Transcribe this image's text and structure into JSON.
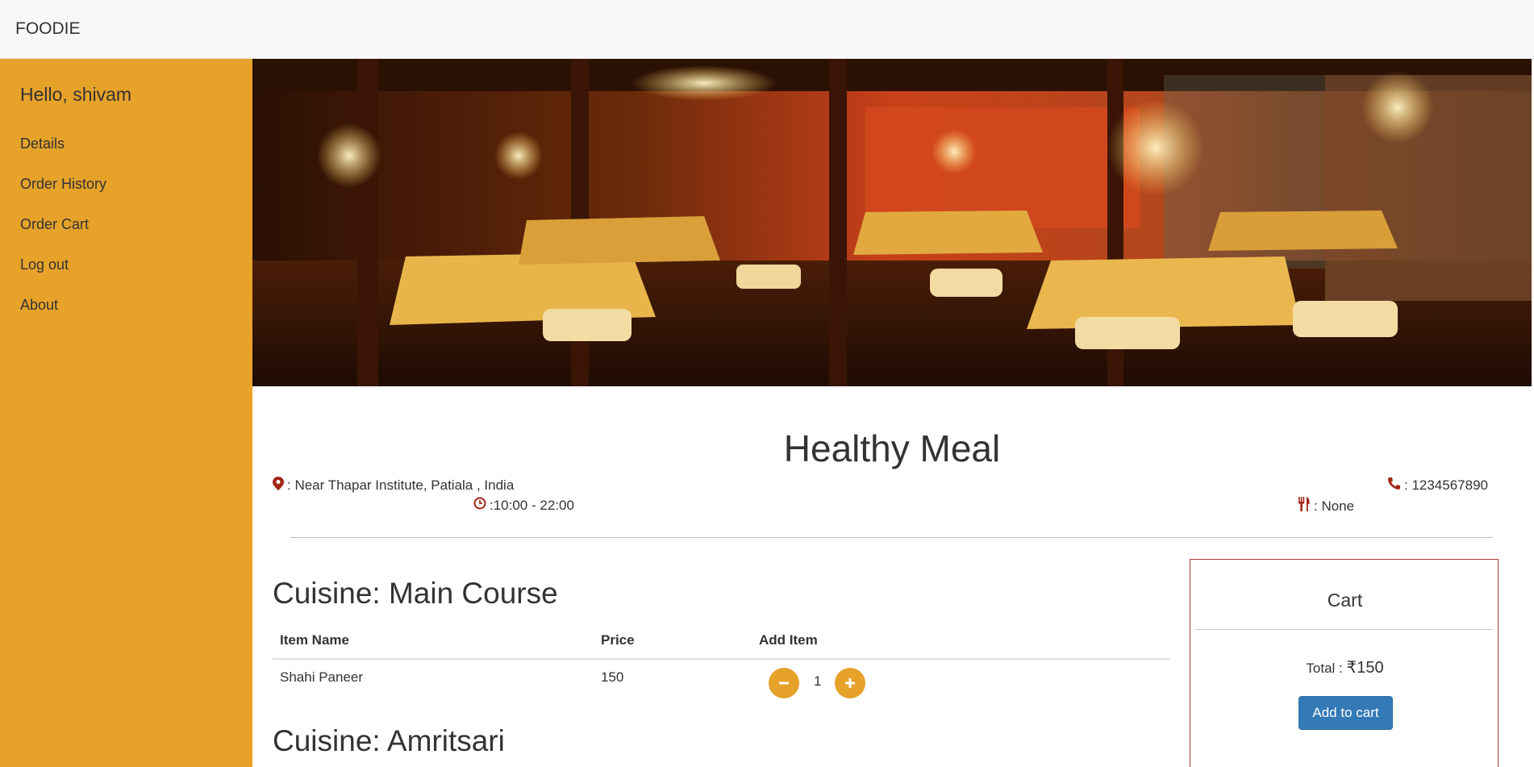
{
  "navbar": {
    "brand": "FOODIE"
  },
  "sidebar": {
    "greeting": "Hello, shivam",
    "items": [
      {
        "label": "Details"
      },
      {
        "label": "Order History"
      },
      {
        "label": "Order Cart"
      },
      {
        "label": "Log out"
      },
      {
        "label": "About"
      }
    ]
  },
  "restaurant": {
    "name": "Healthy Meal",
    "address": ": Near Thapar Institute, Patiala , India",
    "hours": ":10:00 - 22:00",
    "phone": ": 1234567890",
    "cuisine_tag": ": None"
  },
  "menu": {
    "headers": {
      "item": "Item Name",
      "price": "Price",
      "add": "Add Item"
    },
    "sections": [
      {
        "title": "Cuisine: Main Course",
        "items": [
          {
            "name": "Shahi Paneer",
            "price": "150",
            "qty": "1"
          }
        ]
      },
      {
        "title": "Cuisine: Amritsari",
        "items": []
      }
    ]
  },
  "cart": {
    "title": "Cart",
    "total_label": "Total : ",
    "total_value": "₹150",
    "button_label": "Add to cart"
  },
  "colors": {
    "sidebar": "#e6a229",
    "icon_red": "#a32617",
    "button_blue": "#337ab7",
    "cart_border": "#b03a2e"
  },
  "icons": [
    "map-marker-icon",
    "clock-icon",
    "phone-icon",
    "cutlery-icon",
    "minus-icon",
    "plus-icon"
  ]
}
